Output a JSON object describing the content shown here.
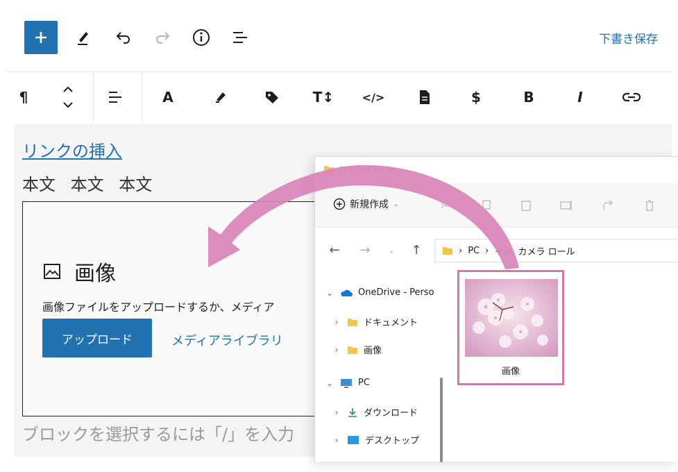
{
  "toolbar": {
    "draft_save": "下書き保存"
  },
  "format_toolbar": {
    "paragraph": "¶",
    "text_color": "A",
    "typography": "T↕",
    "code": "</>",
    "dollar": "$",
    "bold": "B",
    "italic": "I"
  },
  "editor": {
    "link_text": "リンクの挿入",
    "body_text": "本文 本文 本文",
    "image_block": {
      "title": "画像",
      "description": "画像ファイルをアップロードするか、メディア",
      "upload_label": "アップロード",
      "media_library_label": "メディアライブラリ"
    },
    "placeholder": "ブロックを選択するには「/」を入力"
  },
  "explorer": {
    "title": "カメラ ロール",
    "new_label": "新規作成",
    "address": {
      "pc": "PC",
      "pictures": "ャ",
      "camera_roll": "カメラ ロール"
    },
    "tree": [
      {
        "label": "OneDrive - Perso"
      },
      {
        "label": "ドキュメント"
      },
      {
        "label": "画像"
      },
      {
        "label": "PC"
      },
      {
        "label": "ダウンロード"
      },
      {
        "label": "デスクトップ"
      }
    ],
    "file": {
      "name": "画像"
    }
  },
  "colors": {
    "accent": "#2271b1",
    "arrow": "#d883b8",
    "highlight": "#cf7bb1"
  }
}
